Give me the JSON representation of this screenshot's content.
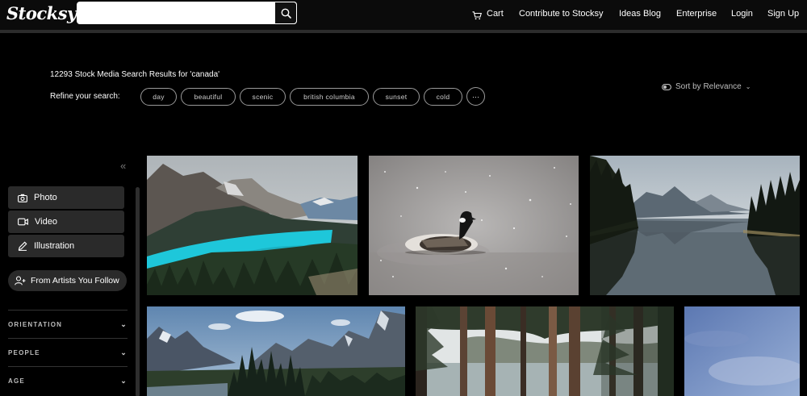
{
  "header": {
    "logo": "Stocksy",
    "search": {
      "value": "",
      "placeholder": ""
    },
    "nav": {
      "cart": "Cart",
      "contribute": "Contribute to Stocksy",
      "ideas_blog": "Ideas Blog",
      "enterprise": "Enterprise",
      "login": "Login",
      "sign_up": "Sign Up"
    }
  },
  "results": {
    "count_text": "12293 Stock Media Search Results for 'canada'",
    "refine_label": "Refine your search:",
    "chips": [
      "day",
      "beautiful",
      "scenic",
      "british columbia",
      "sunset",
      "cold"
    ],
    "more_label": "···",
    "sort_label": "Sort by Relevance"
  },
  "sidebar": {
    "collapse": "«",
    "media_types": [
      "Photo",
      "Video",
      "Illustration"
    ],
    "follow_button": "From Artists You Follow",
    "filters": [
      "ORIENTATION",
      "PEOPLE",
      "AGE"
    ]
  },
  "grid": {
    "images": [
      "lake-mountain-turquoise",
      "canada-goose-snow",
      "mountain-lake-reflection",
      "mountain-forest-valley",
      "pine-forest-lake",
      "blue-sky-partial"
    ]
  },
  "colors": {
    "background": "#000000",
    "header": "#0b0b0b",
    "button_bg": "#2a2a2a",
    "chip_border": "#9a9a9a"
  }
}
